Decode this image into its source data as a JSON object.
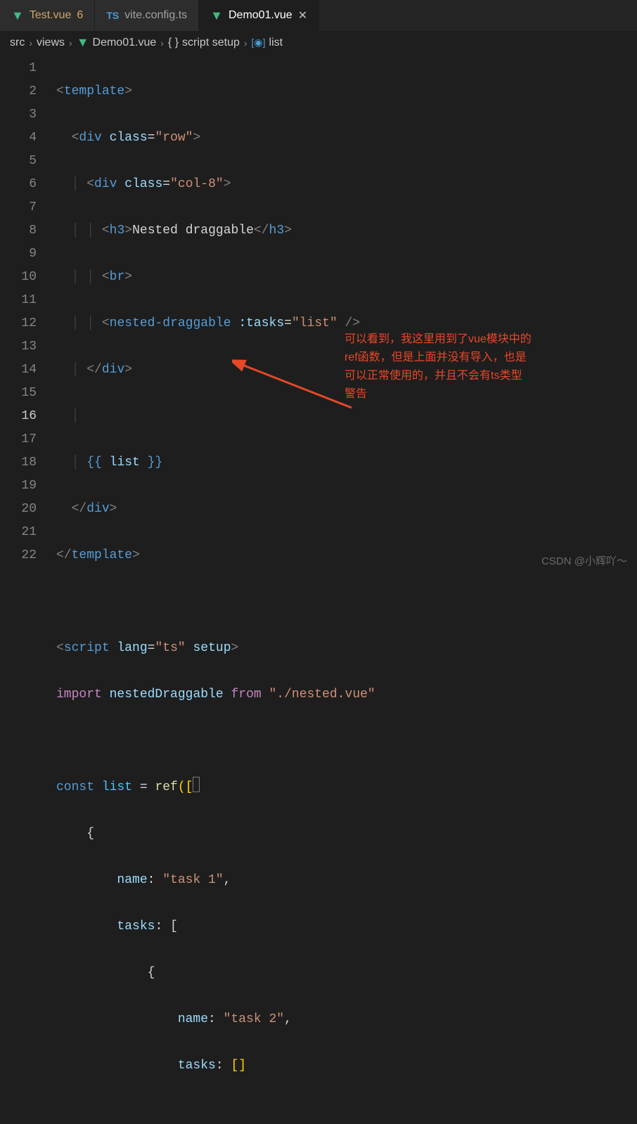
{
  "tabs": [
    {
      "name": "Test.vue",
      "icon": "vue",
      "badge": "6",
      "modified": true,
      "active": false
    },
    {
      "name": "vite.config.ts",
      "icon": "ts",
      "badge": "",
      "modified": false,
      "active": false
    },
    {
      "name": "Demo01.vue",
      "icon": "vue",
      "badge": "",
      "modified": false,
      "active": true
    }
  ],
  "breadcrumbs": {
    "src": "src",
    "views": "views",
    "file": "Demo01.vue",
    "scope": "script setup",
    "symbol": "list"
  },
  "lines": {
    "l1": {
      "n": "1"
    },
    "l2": {
      "n": "2"
    },
    "l3": {
      "n": "3"
    },
    "l4": {
      "n": "4",
      "text": "Nested draggable"
    },
    "l5": {
      "n": "5"
    },
    "l6": {
      "n": "6",
      "attr": ":tasks",
      "val": "\"list\""
    },
    "l7": {
      "n": "7"
    },
    "l8": {
      "n": "8"
    },
    "l9": {
      "n": "9",
      "expr": "list"
    },
    "l10": {
      "n": "10"
    },
    "l11": {
      "n": "11"
    },
    "l12": {
      "n": "12"
    },
    "l13": {
      "n": "13",
      "lang": "\"ts\""
    },
    "l14": {
      "n": "14",
      "imp": "nestedDraggable",
      "from": "\"./nested.vue\""
    },
    "l15": {
      "n": "15"
    },
    "l16": {
      "n": "16",
      "const": "list",
      "fn": "ref"
    },
    "l17": {
      "n": "17"
    },
    "l18": {
      "n": "18",
      "key": "name",
      "val": "\"task 1\""
    },
    "l19": {
      "n": "19",
      "key": "tasks"
    },
    "l20": {
      "n": "20"
    },
    "l21": {
      "n": "21",
      "key": "name",
      "val": "\"task 2\""
    },
    "l22": {
      "n": "22",
      "key": "tasks"
    }
  },
  "tags": {
    "template": "template",
    "div": "div",
    "h3": "h3",
    "br": "br",
    "nested": "nested-draggable",
    "script": "script"
  },
  "attrs": {
    "class": "class",
    "row": "\"row\"",
    "col8": "\"col-8\"",
    "lang": "lang",
    "setup": "setup"
  },
  "kw": {
    "import": "import",
    "from": "from",
    "const": "const"
  },
  "ops": {
    "eq": " = "
  },
  "annotation": {
    "l1": "可以看到，我这里用到了vue模块中的",
    "l2": "ref函数，但是上面并没有导入，也是",
    "l3": "可以正常使用的，并且不会有ts类型",
    "l4": "警告"
  },
  "watermark": "CSDN @小辉吖～"
}
